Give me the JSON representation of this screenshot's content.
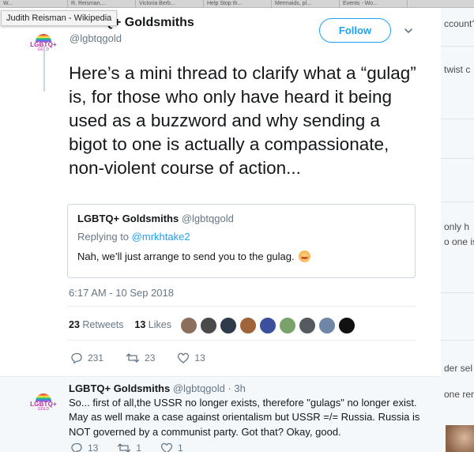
{
  "browser": {
    "tabs": [
      "W...",
      "R. Reisman,...",
      "Victoria Berb...",
      "Help Stop th...",
      "Mermaids, pl...",
      "Events - Wo..."
    ],
    "tooltip": "Judith Reisman - Wikipedia"
  },
  "background": {
    "fragments": [
      "ccount?",
      "twist c",
      "only h",
      "o one is",
      "der sel",
      "one ren"
    ]
  },
  "tweet": {
    "author_name": "LGBTQ+ Goldsmiths",
    "author_handle": "@lgbtqgold",
    "avatar": {
      "text": "LGBTQ+",
      "subtext": "GOLD"
    },
    "follow_label": "Follow",
    "text": "Here’s a mini thread to clarify what a “gulag” is, for those who only have heard it being used as a buzzword and why sending a bigot to one is actually a compassionate, non-violent course of action...",
    "quote": {
      "author_name": "LGBTQ+ Goldsmiths",
      "author_handle": "@lgbtqgold",
      "replying_prefix": "Replying to",
      "replying_to": "@mrkhtake2",
      "text": "Nah, we’ll just arrange to send you to the gulag."
    },
    "timestamp": "6:17 AM - 10 Sep 2018",
    "retweets_count": "23",
    "retweets_label": "Retweets",
    "likes_count": "13",
    "likes_label": "Likes",
    "actions": {
      "replies": "231",
      "retweets": "23",
      "likes": "13"
    }
  },
  "reply": {
    "author_name": "LGBTQ+ Goldsmiths",
    "author_handle": "@lgbtqgold",
    "separator": "·",
    "time": "3h",
    "text": "So... first of all,the USSR no longer exists, therefore \"gulags\" no longer exist. May as well make a case against orientalism but USSR =/= Russia. Russia is NOT governed by a communist party. Got that? Okay, good.",
    "actions": {
      "replies": "13",
      "retweets": "1",
      "likes": "1"
    }
  },
  "colors": {
    "accent": "#1da1f2",
    "text": "#14171a",
    "muted": "#657786",
    "border": "#ccd6dd"
  },
  "icons": [
    "chevron-down-icon",
    "reply-icon",
    "retweet-icon",
    "heart-icon",
    "smiling-emoji-icon"
  ]
}
